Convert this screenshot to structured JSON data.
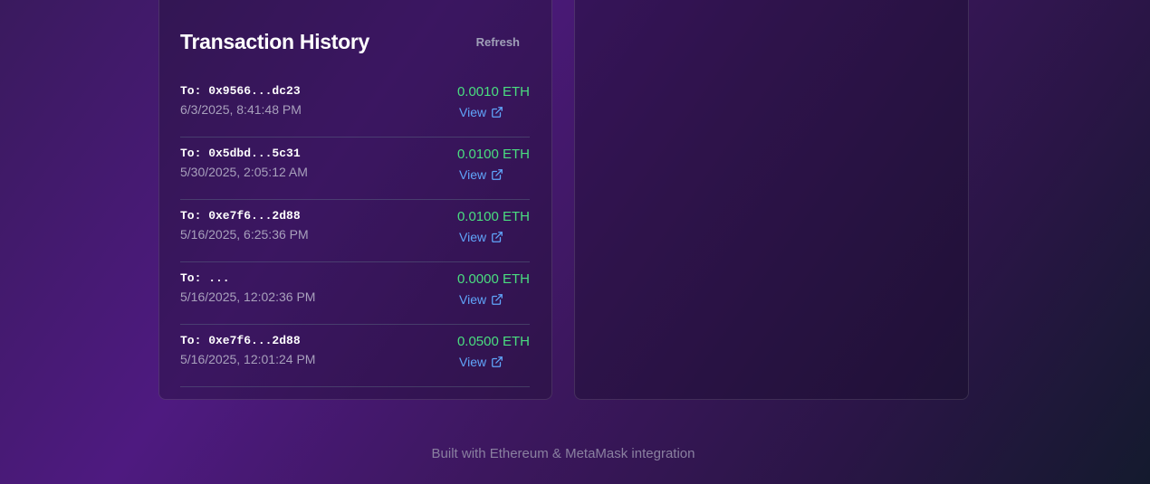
{
  "transaction_history": {
    "title": "Transaction History",
    "refresh_label": "Refresh",
    "transactions": [
      {
        "to": "To: 0x9566...dc23",
        "date": "6/3/2025, 8:41:48 PM",
        "amount": "0.0010 ETH",
        "view_label": "View"
      },
      {
        "to": "To: 0x5dbd...5c31",
        "date": "5/30/2025, 2:05:12 AM",
        "amount": "0.0100 ETH",
        "view_label": "View"
      },
      {
        "to": "To: 0xe7f6...2d88",
        "date": "5/16/2025, 6:25:36 PM",
        "amount": "0.0100 ETH",
        "view_label": "View"
      },
      {
        "to": "To: ...",
        "date": "5/16/2025, 12:02:36 PM",
        "amount": "0.0000 ETH",
        "view_label": "View"
      },
      {
        "to": "To: 0xe7f6...2d88",
        "date": "5/16/2025, 12:01:24 PM",
        "amount": "0.0500 ETH",
        "view_label": "View"
      }
    ]
  },
  "footer": {
    "text": "Built with Ethereum & MetaMask integration"
  },
  "colors": {
    "amount": "#4ade80",
    "link": "#60a5fa",
    "accent_background": "#4e1a80"
  },
  "icons": {
    "view_link": "external-link-icon"
  }
}
